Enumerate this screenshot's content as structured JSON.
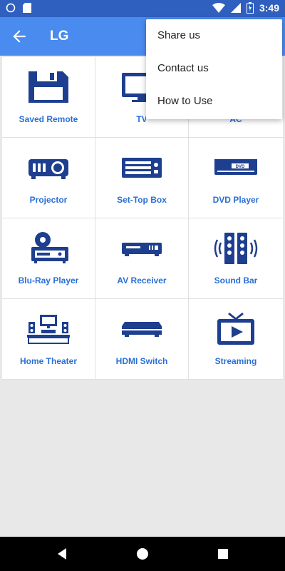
{
  "status_bar": {
    "time": "3:49"
  },
  "app_bar": {
    "title": "LG"
  },
  "menu": {
    "items": [
      "Share us",
      "Contact us",
      "How to Use"
    ]
  },
  "grid": {
    "items": [
      {
        "label": "Saved Remote",
        "icon": "floppy-disk-icon"
      },
      {
        "label": "TV",
        "icon": "tv-icon"
      },
      {
        "label": "AC",
        "icon": "ac-icon"
      },
      {
        "label": "Projector",
        "icon": "projector-icon"
      },
      {
        "label": "Set-Top Box",
        "icon": "set-top-box-icon"
      },
      {
        "label": "DVD Player",
        "icon": "dvd-player-icon"
      },
      {
        "label": "Blu-Ray Player",
        "icon": "blu-ray-player-icon"
      },
      {
        "label": "AV Receiver",
        "icon": "av-receiver-icon"
      },
      {
        "label": "Sound Bar",
        "icon": "sound-bar-icon"
      },
      {
        "label": "Home Theater",
        "icon": "home-theater-icon"
      },
      {
        "label": "HDMI Switch",
        "icon": "hdmi-switch-icon"
      },
      {
        "label": "Streaming",
        "icon": "streaming-icon"
      }
    ],
    "dvd_icon_text": "DVD"
  },
  "colors": {
    "icon": "#1e3f8f",
    "label": "#2a6fd6",
    "appbar": "#4a8bef",
    "statusbar": "#2f5fbf"
  }
}
